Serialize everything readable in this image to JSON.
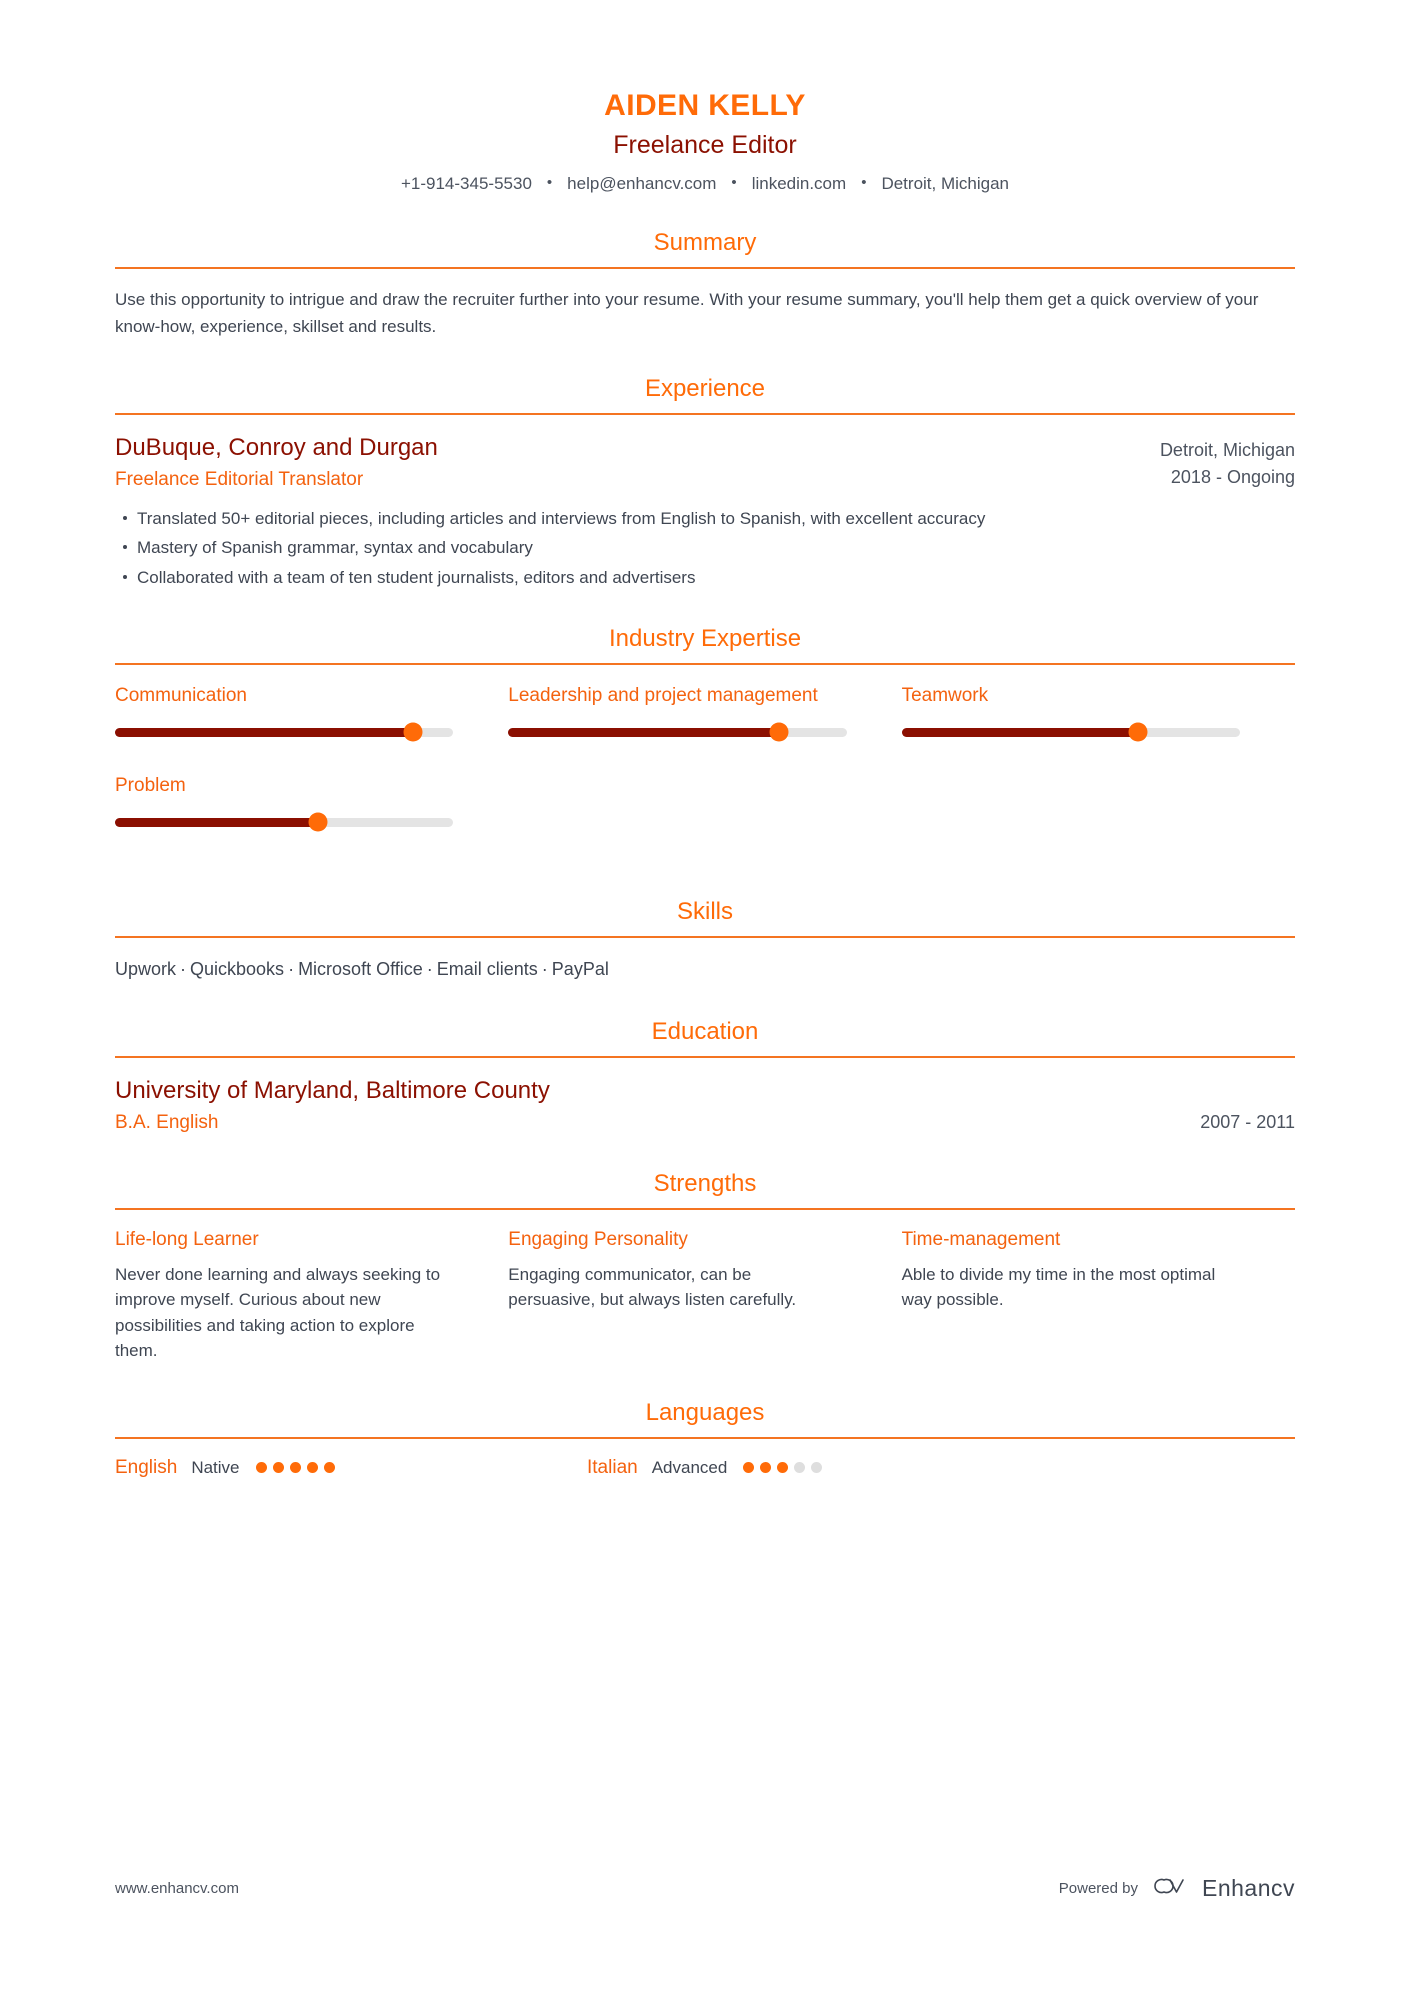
{
  "header": {
    "name": "AIDEN KELLY",
    "role": "Freelance Editor",
    "contacts": [
      "+1-914-345-5530",
      "help@enhancv.com",
      "linkedin.com",
      "Detroit, Michigan"
    ]
  },
  "sections": {
    "summary": {
      "title": "Summary",
      "text": "Use this opportunity to intrigue and draw the recruiter further into your resume. With your resume summary, you'll help them get a quick overview of your know-how, experience, skillset and results."
    },
    "experience": {
      "title": "Experience",
      "entries": [
        {
          "company": "DuBuque, Conroy and Durgan",
          "role": "Freelance Editorial Translator",
          "location": "Detroit, Michigan",
          "dates": "2018 - Ongoing",
          "bullets": [
            "Translated 50+ editorial pieces, including articles and interviews from English to Spanish, with excellent accuracy",
            "Mastery of Spanish grammar, syntax and vocabulary",
            "Collaborated with a team of ten student journalists, editors and advertisers"
          ]
        }
      ]
    },
    "industry_expertise": {
      "title": "Industry Expertise",
      "items": [
        {
          "label": "Communication",
          "value": 88
        },
        {
          "label": "Leadership and project management",
          "value": 80
        },
        {
          "label": "Teamwork",
          "value": 70
        },
        {
          "label": "Problem",
          "value": 60
        }
      ]
    },
    "skills": {
      "title": "Skills",
      "items": [
        "Upwork",
        "Quickbooks",
        "Microsoft Office",
        "Email clients",
        "PayPal"
      ],
      "separator": "·"
    },
    "education": {
      "title": "Education",
      "entries": [
        {
          "school": "University of Maryland, Baltimore County",
          "degree": "B.A. English",
          "dates": "2007 - 2011"
        }
      ]
    },
    "strengths": {
      "title": "Strengths",
      "items": [
        {
          "title": "Life-long Learner",
          "description": "Never done learning and always seeking to improve myself. Curious about new possibilities and taking action to explore them."
        },
        {
          "title": "Engaging Personality",
          "description": "Engaging communicator, can be persuasive, but always listen carefully."
        },
        {
          "title": "Time-management",
          "description": "Able to divide my time in the most optimal way possible."
        }
      ]
    },
    "languages": {
      "title": "Languages",
      "items": [
        {
          "name": "English",
          "level": "Native",
          "dots_filled": 5,
          "dots_total": 5
        },
        {
          "name": "Italian",
          "level": "Advanced",
          "dots_filled": 3,
          "dots_total": 5
        }
      ]
    }
  },
  "footer": {
    "url": "www.enhancv.com",
    "powered_by": "Powered by",
    "brand": "Enhancv"
  },
  "colors": {
    "accent_orange": "#ff6b08",
    "rule_orange": "#f47421",
    "dark_red": "#8b1001",
    "slider_fill": "#8b0f01",
    "slider_track": "#e4e4e4",
    "body_text": "#3f4652",
    "muted_text": "#4c535f",
    "dot_off": "#dedede"
  }
}
